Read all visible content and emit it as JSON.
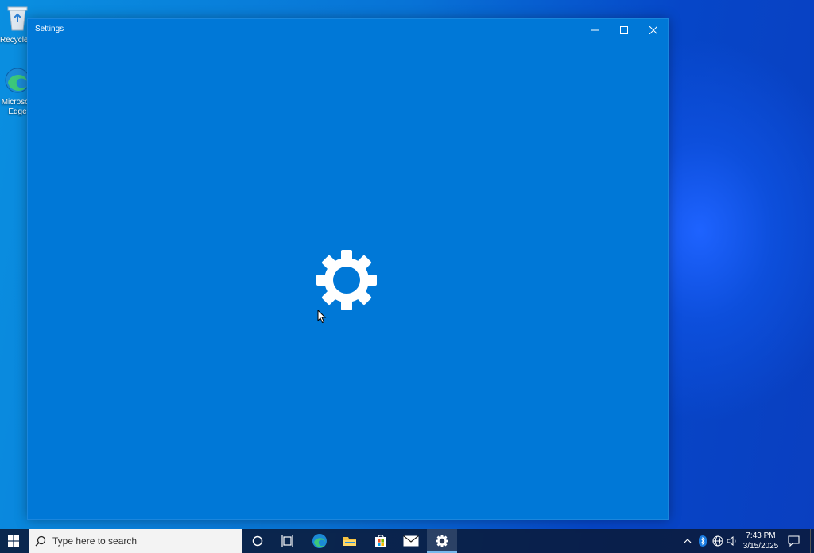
{
  "desktop": {
    "icons": [
      {
        "label": "Recycle Bin",
        "icon": "recycle-bin-icon"
      },
      {
        "label": "Microsoft Edge",
        "icon": "edge-icon"
      }
    ]
  },
  "window": {
    "title": "Settings",
    "splash_icon": "gear-icon",
    "buttons": {
      "minimize": "minimize-icon",
      "maximize": "maximize-icon",
      "close": "close-icon"
    }
  },
  "taskbar": {
    "search_placeholder": "Type here to search",
    "apps": [
      "cortana",
      "task-view",
      "microsoft-edge",
      "file-explorer",
      "microsoft-store",
      "mail",
      "settings"
    ],
    "active_app": "settings",
    "tray": {
      "time": "7:43 PM",
      "date": "3/15/2025"
    }
  },
  "colors": {
    "window_bg": "#0078d7",
    "taskbar_bg": "#0a1a3a",
    "accent": "#76b9ed"
  }
}
